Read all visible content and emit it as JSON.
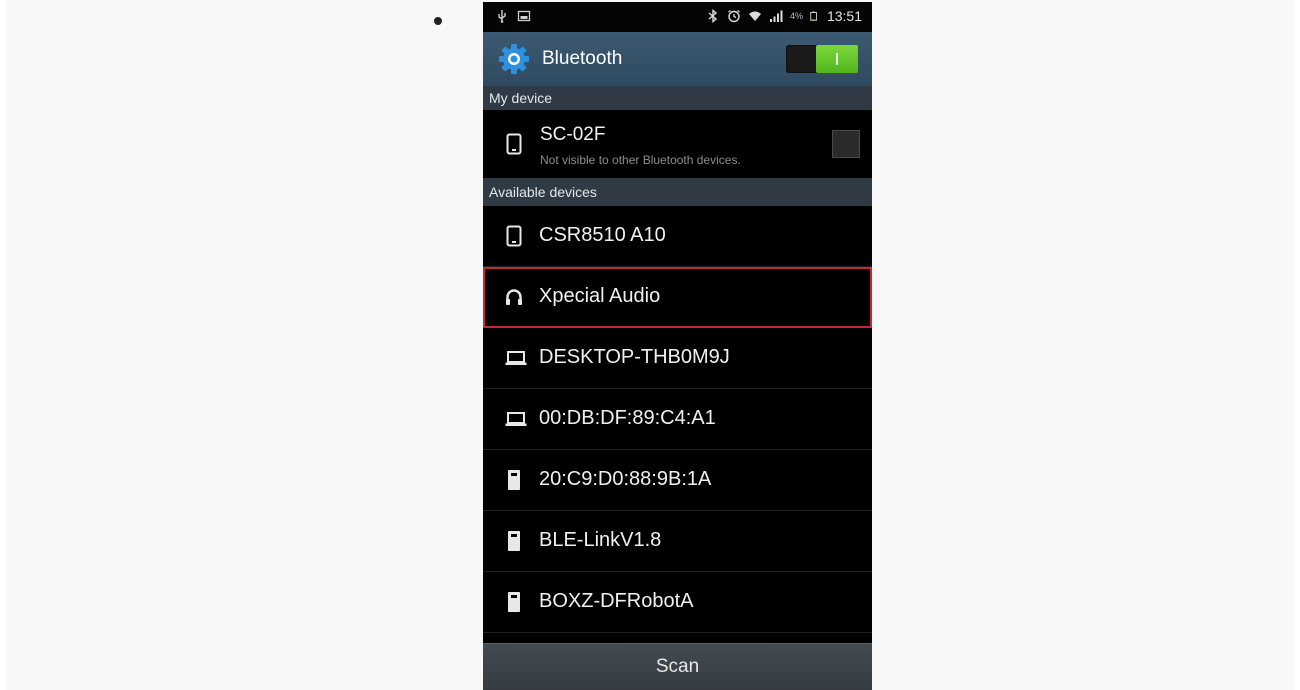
{
  "status_bar": {
    "icons": [
      "usb-icon",
      "image-icon",
      "bluetooth-icon",
      "alarm-icon",
      "wifi-icon",
      "signal-icon",
      "battery-icon"
    ],
    "battery_percent": "4%",
    "time": "13:51"
  },
  "action_bar": {
    "title": "Bluetooth",
    "toggle_on": true
  },
  "my_device": {
    "header": "My device",
    "name": "SC-02F",
    "subtitle": "Not visible to other Bluetooth devices."
  },
  "available": {
    "header": "Available devices",
    "devices": [
      {
        "name": "CSR8510 A10",
        "icon": "phone-icon"
      },
      {
        "name": "Xpecial Audio",
        "icon": "headphones-icon"
      },
      {
        "name": "DESKTOP-THB0M9J",
        "icon": "laptop-icon"
      },
      {
        "name": "00:DB:DF:89:C4:A1",
        "icon": "laptop-icon"
      },
      {
        "name": "20:C9:D0:88:9B:1A",
        "icon": "device-icon"
      },
      {
        "name": "BLE-LinkV1.8",
        "icon": "device-icon"
      },
      {
        "name": "BOXZ-DFRobotA",
        "icon": "device-icon"
      }
    ]
  },
  "scan_button": {
    "label": "Scan"
  },
  "colors": {
    "action_bar": "#3a566d",
    "section_header": "#2f3a45",
    "toggle_on": "#6cc62e",
    "highlight_border": "#c12a35"
  }
}
